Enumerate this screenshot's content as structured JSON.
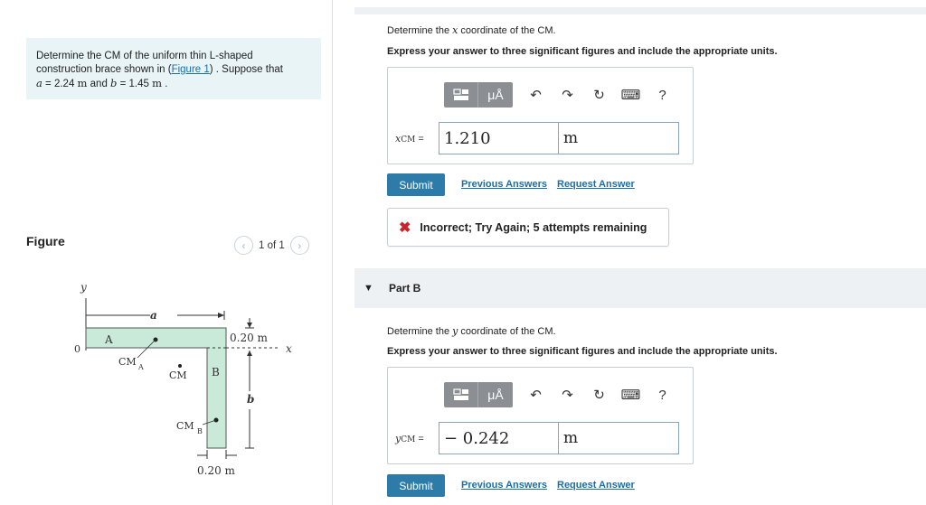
{
  "problem": {
    "text_before_link": "Determine the CM of the uniform thin L-shaped construction brace shown in (",
    "link": "Figure 1",
    "text_after_link": ") . Suppose that",
    "a_var": "a",
    "a_value": " = 2.24 ",
    "a_unit": "m",
    "and_word": " and ",
    "b_var": "b",
    "b_value": " = 1.45 ",
    "b_unit": "m",
    "end": " ."
  },
  "figure_panel": {
    "label": "Figure",
    "pager_text": "1 of 1",
    "prev_icon": "chevron-left-icon",
    "next_icon": "chevron-right-icon"
  },
  "figure": {
    "y_axis": "y",
    "x_axis": "x",
    "origin": "0",
    "dim_a": "a",
    "dim_b": "b",
    "point_A": "A",
    "point_B": "B",
    "cm_a": "CM",
    "cm_a_sub": "A",
    "cm": "CM",
    "cm_b": "CM",
    "cm_b_sub": "B",
    "thickness_top": "0.20 m",
    "thickness_bottom": "0.20 m"
  },
  "part_a": {
    "question": "Determine the x coordinate of the CM.",
    "question_pre": "Determine the ",
    "question_var": "x",
    "question_post": " coordinate of the CM.",
    "instruction": "Express your answer to three significant figures and include the appropriate units.",
    "label_var": "x",
    "label_sub": "CM",
    "label_eq": " =",
    "value": "1.210",
    "unit": "m",
    "submit": "Submit",
    "previous_answers": "Previous Answers",
    "request_answer": "Request Answer",
    "feedback_icon": "x-mark-icon",
    "feedback": "Incorrect; Try Again; 5 attempts remaining"
  },
  "part_b": {
    "title": "Part B",
    "question_pre": "Determine the ",
    "question_var": "y",
    "question_post": " coordinate of the CM.",
    "instruction": "Express your answer to three significant figures and include the appropriate units.",
    "label_var": "y",
    "label_sub": "CM",
    "label_eq": " =",
    "value": "− 0.242",
    "unit": "m",
    "submit": "Submit",
    "previous_answers": "Previous Answers",
    "request_answer": "Request Answer"
  },
  "toolbar": {
    "templates_icon": "templates-icon",
    "units_label": "μÅ",
    "undo_icon": "undo-icon",
    "redo_icon": "redo-icon",
    "reset_icon": "reset-icon",
    "keyboard_icon": "keyboard-icon",
    "help_label": "?"
  },
  "colors": {
    "accent": "#2c7ba8",
    "link": "#1a6ea8",
    "error": "#c8242b",
    "problem_bg": "#e8f4f6",
    "brace_fill": "#c9ead8"
  }
}
